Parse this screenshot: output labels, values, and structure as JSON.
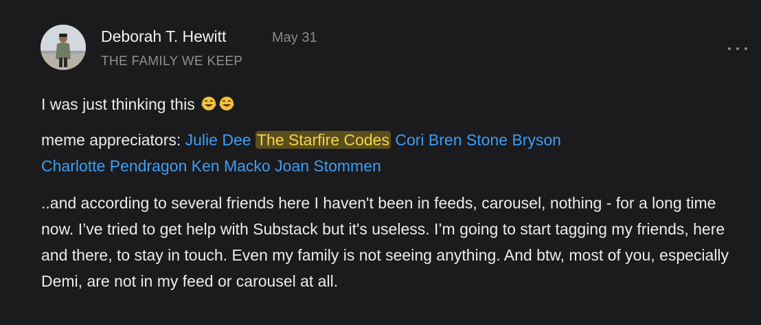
{
  "post": {
    "author": "Deborah T. Hewitt",
    "date": "May 31",
    "publication": "THE FAMILY WE KEEP",
    "line1_text": "I was just thinking this",
    "line1_emoji": [
      "face-with-tears-of-joy-icon",
      "face-with-tears-of-joy-icon"
    ],
    "mentions_prefix": "meme appreciators:",
    "mentions": [
      {
        "name": "Julie Dee",
        "highlighted": false
      },
      {
        "name": "The Starfire Codes",
        "highlighted": true
      },
      {
        "name": "Cori Bren",
        "highlighted": false
      },
      {
        "name": "Stone Bryson",
        "highlighted": false
      },
      {
        "name": "Charlotte Pendragon",
        "highlighted": false
      },
      {
        "name": "Ken Macko",
        "highlighted": false
      },
      {
        "name": "Joan Stommen",
        "highlighted": false
      }
    ],
    "body": "..and according to several friends here I haven't been in feeds, carousel, nothing - for a long time now. I’ve tried to get help with Substack but it's useless. I’m going to start tagging my friends, here and there, to stay in touch. Even my family is not seeing anything. And btw, most of you, especially Demi, are not in my feed or carousel at all."
  },
  "colors": {
    "background": "#1b1b1d",
    "mention": "#3d9df6",
    "highlight_bg": "#5a4e1c",
    "highlight_text": "#f3d54a"
  },
  "menu": {
    "icon": "more-horizontal-icon"
  }
}
